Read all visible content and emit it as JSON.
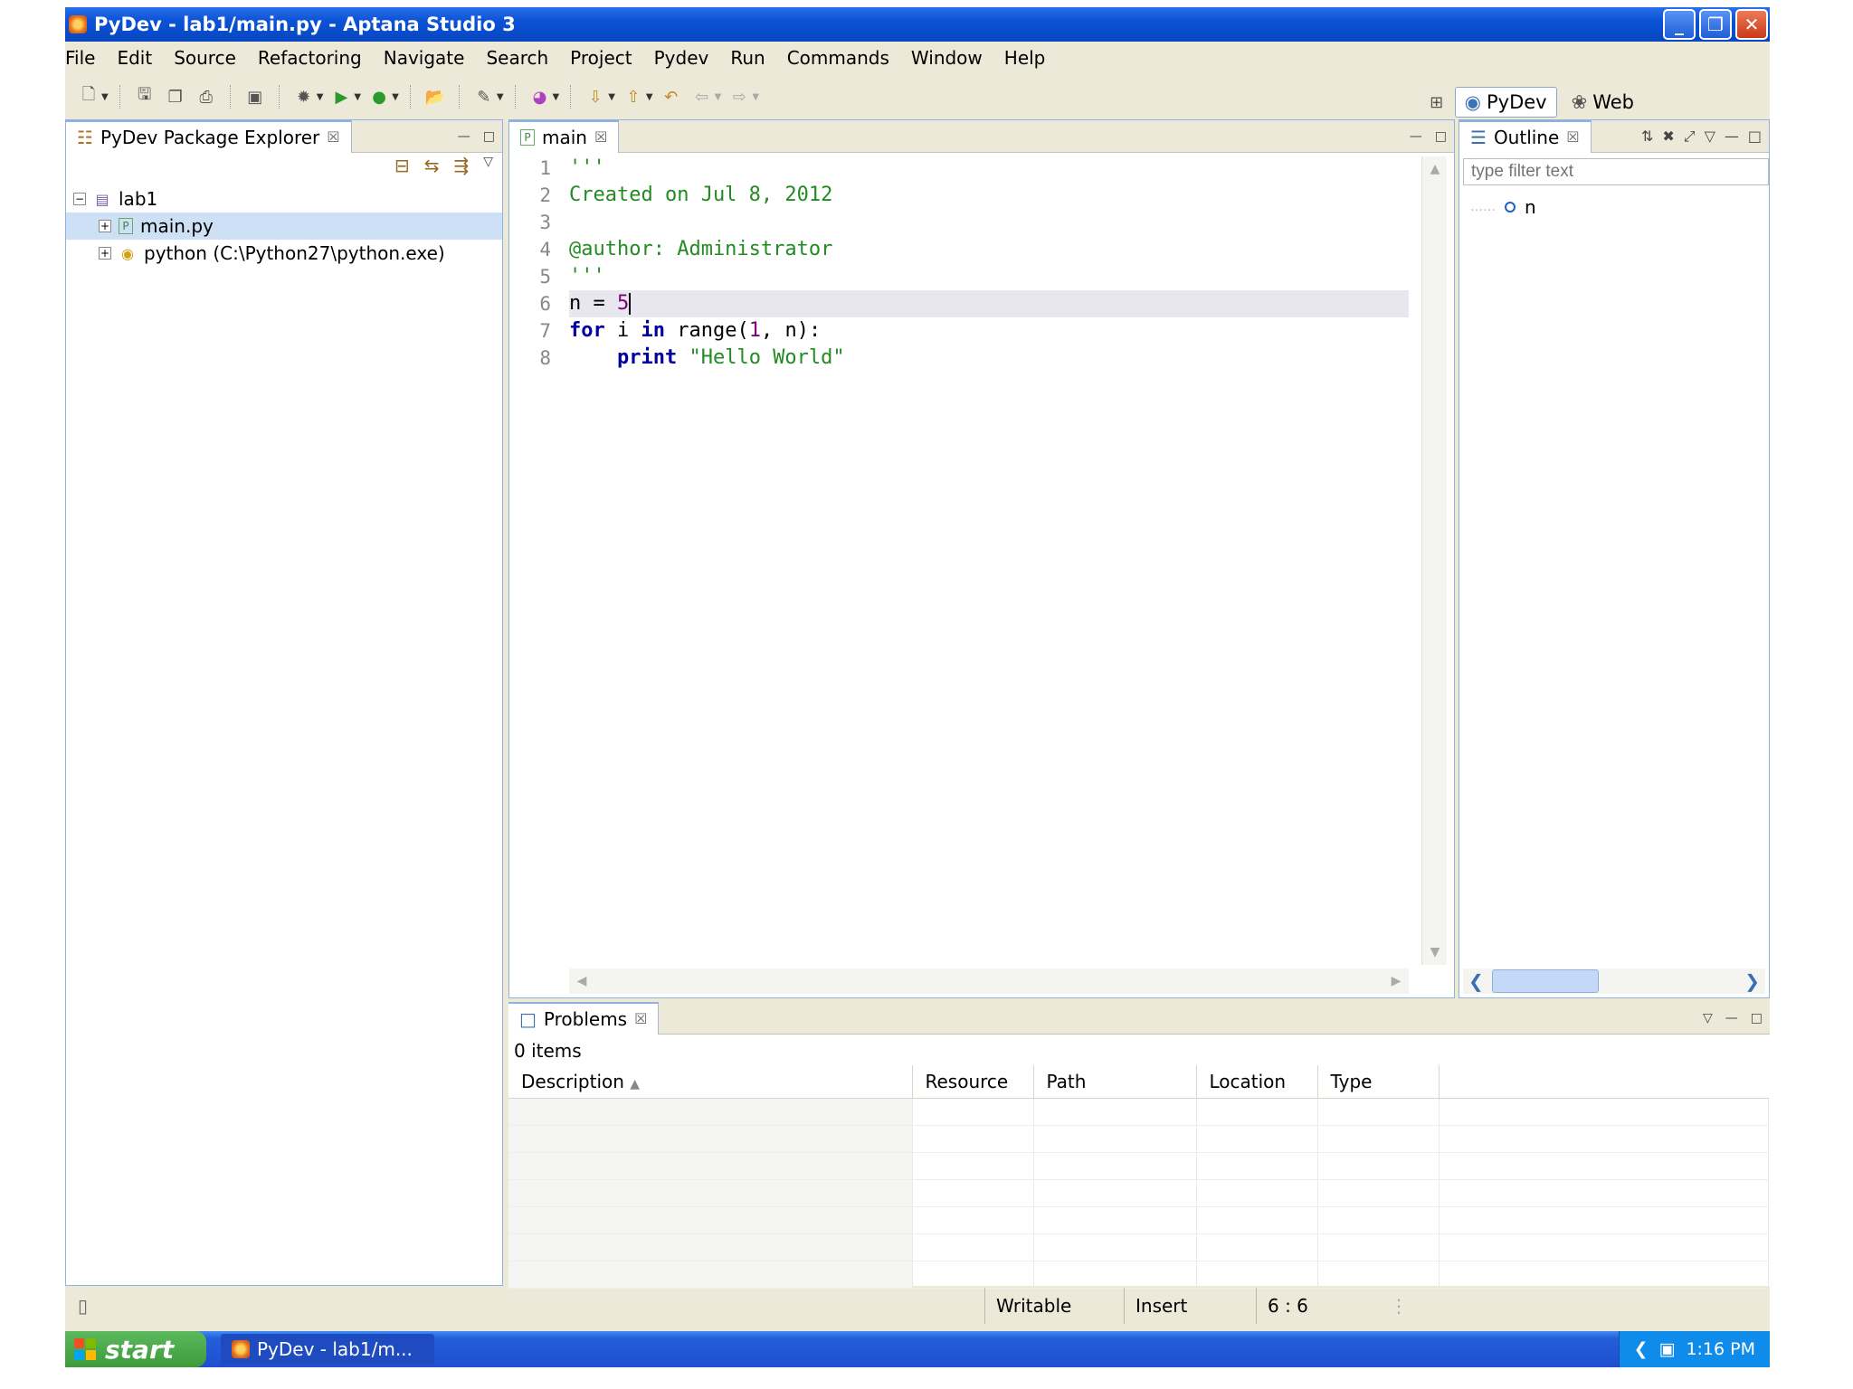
{
  "window": {
    "title": "PyDev - lab1/main.py - Aptana Studio 3",
    "minimize": "_",
    "maximize": "❐",
    "close": "✕"
  },
  "menu": [
    "File",
    "Edit",
    "Source",
    "Refactoring",
    "Navigate",
    "Search",
    "Project",
    "Pydev",
    "Run",
    "Commands",
    "Window",
    "Help"
  ],
  "perspectives": {
    "pydev": "PyDev",
    "web": "Web"
  },
  "explorer": {
    "title": "PyDev Package Explorer",
    "items": [
      {
        "label": "lab1",
        "icon": "project-icon"
      },
      {
        "label": "main.py",
        "icon": "python-file-icon",
        "selected": true
      },
      {
        "label": "python  (C:\\Python27\\python.exe)",
        "icon": "python-interpreter-icon"
      }
    ]
  },
  "editor": {
    "tab": "main",
    "line_numbers": [
      "1",
      "2",
      "3",
      "4",
      "5",
      "6",
      "7",
      "8"
    ],
    "current_line": 6
  },
  "outline": {
    "title": "Outline",
    "filter_placeholder": "type filter text",
    "items": [
      "n"
    ]
  },
  "problems": {
    "title": "Problems",
    "count": "0 items",
    "columns": [
      "Description",
      "Resource",
      "Path",
      "Location",
      "Type"
    ]
  },
  "status": {
    "writable": "Writable",
    "mode": "Insert",
    "position": "6 : 6"
  },
  "taskbar": {
    "start": "start",
    "task": "PyDev - lab1/m...",
    "clock": "1:16 PM"
  },
  "colors": {
    "titlebar": "#0a52d6",
    "string": "#228b22",
    "keyword": "#00009f",
    "number": "#800080",
    "selection": "#cde0f6"
  }
}
